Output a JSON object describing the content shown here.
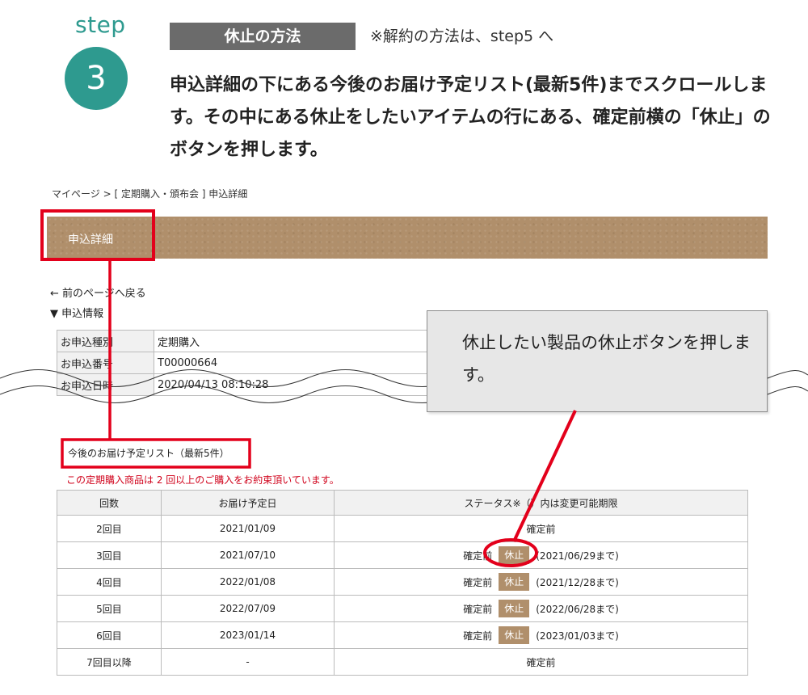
{
  "step": {
    "word": "step",
    "number": "3"
  },
  "method_label": "休止の方法",
  "cancel_note": "※解約の方法は、step5 へ",
  "instruction": "申込詳細の下にある今後のお届け予定リスト(最新5件)までスクロールします。その中にある休止をしたいアイテムの行にある、確定前横の「休止」のボタンを押します。",
  "breadcrumb": "マイページ > [ 定期購入・頒布会 ] 申込詳細",
  "banner_title": "申込詳細",
  "back_link": "← 前のページへ戻る",
  "info_heading": "▼ 申込情報",
  "info_rows": [
    {
      "label": "お申込種別",
      "value": "定期購入"
    },
    {
      "label": "お申込番号",
      "value": "T00000664"
    },
    {
      "label": "お申込日時",
      "value": "2020/04/13 08:10:28"
    }
  ],
  "callout": "休止したい製品の休止ボタンを押します。",
  "schedule_title": "今後のお届け予定リスト（最新5件）",
  "commitment_note": "この定期購入商品は 2 回以上のご購入をお約束頂いています。",
  "table": {
    "headers": [
      "回数",
      "お届け予定日",
      "ステータス※（）内は変更可能期限"
    ],
    "rows": [
      {
        "count": "2回目",
        "date": "2021/01/09",
        "status": "確定前",
        "button": "",
        "deadline": ""
      },
      {
        "count": "3回目",
        "date": "2021/07/10",
        "status": "確定前",
        "button": "休止",
        "deadline": "(2021/06/29まで)"
      },
      {
        "count": "4回目",
        "date": "2022/01/08",
        "status": "確定前",
        "button": "休止",
        "deadline": "(2021/12/28まで)"
      },
      {
        "count": "5回目",
        "date": "2022/07/09",
        "status": "確定前",
        "button": "休止",
        "deadline": "(2022/06/28まで)"
      },
      {
        "count": "6回目",
        "date": "2023/01/14",
        "status": "確定前",
        "button": "休止",
        "deadline": "(2023/01/03まで)"
      },
      {
        "count": "7回目以降",
        "date": "-",
        "status": "確定前",
        "button": "",
        "deadline": ""
      }
    ]
  },
  "colors": {
    "teal": "#2e9a8f",
    "banner": "#b08f6b",
    "highlight": "#e3001b",
    "label_bg": "#6b6b6b"
  }
}
